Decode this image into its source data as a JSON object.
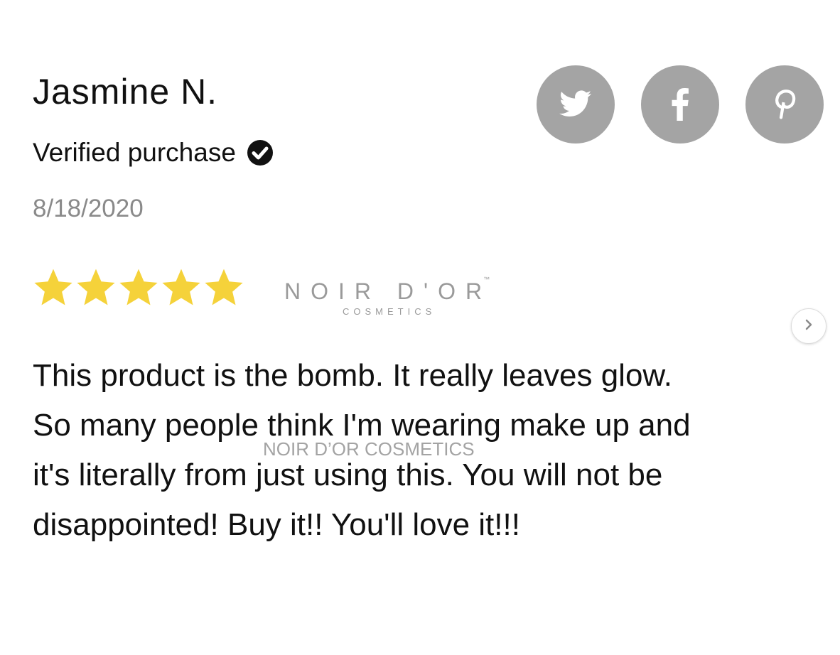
{
  "reviewer": {
    "name": "Jasmine N.",
    "verified_label": "Verified purchase",
    "date": "8/18/2020"
  },
  "rating": {
    "value": 5,
    "max": 5,
    "star_color": "#F5D23A"
  },
  "brand": {
    "name": "NOIR D'OR",
    "trademark": "™",
    "subtitle": "COSMETICS"
  },
  "social": {
    "buttons": [
      {
        "name": "twitter",
        "icon": "twitter-bird-icon"
      },
      {
        "name": "facebook",
        "icon": "facebook-f-icon"
      },
      {
        "name": "pinterest",
        "icon": "pinterest-p-icon"
      }
    ],
    "button_color": "#A4A4A4"
  },
  "review": {
    "lines": [
      "This product is the bomb. It really leaves glow.",
      "So many people think I'm wearing make up and",
      "it's literally from just using this. You will not be",
      "disappointed! Buy it!! You'll love it!!!"
    ]
  },
  "watermark": "NOIR D’OR COSMETICS",
  "navigation": {
    "next_icon": "chevron-right-icon"
  }
}
